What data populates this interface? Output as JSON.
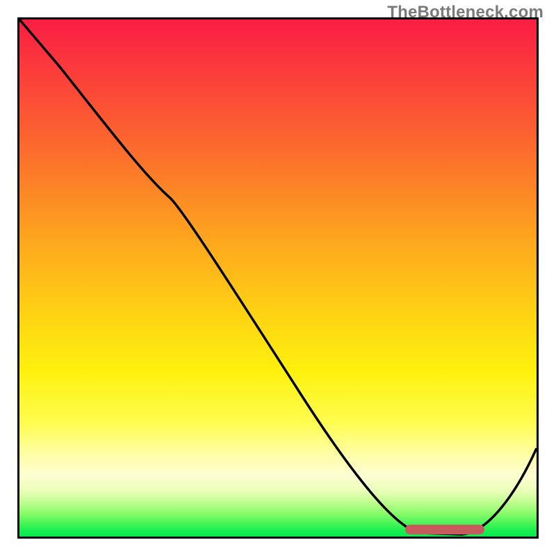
{
  "watermark": "TheBottleneck.com",
  "chart_data": {
    "type": "line",
    "title": "",
    "xlabel": "",
    "ylabel": "",
    "xlim": [
      0,
      100
    ],
    "ylim": [
      0,
      100
    ],
    "grid": false,
    "legend": false,
    "background_gradient": {
      "description": "vertical heat gradient, red (top, bad) -> green (bottom, good)",
      "stops": [
        {
          "pos": 0.0,
          "color": "#fa1d44"
        },
        {
          "pos": 0.25,
          "color": "#fc6a2d"
        },
        {
          "pos": 0.5,
          "color": "#fdc318"
        },
        {
          "pos": 0.7,
          "color": "#fef10e"
        },
        {
          "pos": 0.88,
          "color": "#fdfed2"
        },
        {
          "pos": 1.0,
          "color": "#00ea51"
        }
      ]
    },
    "series": [
      {
        "name": "bottleneck-curve",
        "color": "#000000",
        "x": [
          0,
          8,
          16,
          24,
          30,
          40,
          50,
          58,
          66,
          74,
          80,
          86,
          92,
          100
        ],
        "y": [
          100,
          91,
          81,
          71,
          65,
          51,
          36,
          23,
          11,
          2,
          1,
          1,
          6,
          17
        ]
      }
    ],
    "annotations": [
      {
        "name": "bottleneck-segment",
        "type": "segment",
        "color": "#c85a5f",
        "x_range": [
          75,
          89
        ],
        "y": 1.5,
        "description": "highlighted optimal / bottleneck zone at curve minimum"
      }
    ],
    "watermark": "TheBottleneck.com"
  }
}
